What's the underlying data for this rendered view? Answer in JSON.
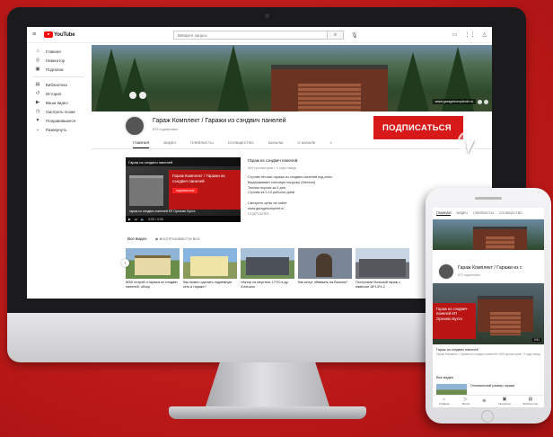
{
  "topbar": {
    "logo_text": "YouTube",
    "search_placeholder": "Введите запрос"
  },
  "sidebar": {
    "items": [
      {
        "icon": "home-icon",
        "glyph": "⌂",
        "label": "Главная"
      },
      {
        "icon": "compass-icon",
        "glyph": "◎",
        "label": "Навигатор"
      },
      {
        "icon": "subscriptions-icon",
        "glyph": "▣",
        "label": "Подписки"
      },
      {
        "icon": "library-icon",
        "glyph": "▤",
        "label": "Библиотека"
      },
      {
        "icon": "history-icon",
        "glyph": "↺",
        "label": "История"
      },
      {
        "icon": "my-videos-icon",
        "glyph": "▶",
        "label": "Ваши видео"
      },
      {
        "icon": "watch-later-icon",
        "glyph": "◷",
        "label": "Смотреть позже"
      },
      {
        "icon": "liked-icon",
        "glyph": "♥",
        "label": "Понравившиеся"
      },
      {
        "icon": "expand-icon",
        "glyph": "⌄",
        "label": "Развернуть"
      }
    ]
  },
  "banner": {
    "link_text": "www.garagekompleckt.ru"
  },
  "channel": {
    "title": "Гараж Комплект / Гаражи из сэндвич панелей",
    "subscribers": "672 подписчика",
    "subscribe_label": "ПОДПИСАТЬСЯ",
    "tabs": [
      "ГЛАВНАЯ",
      "ВИДЕО",
      "ПЛЕЙЛИСТЫ",
      "СООБЩЕСТВО",
      "КАНАЛЫ",
      "О КАНАЛЕ"
    ]
  },
  "featured": {
    "thumb_title": "Гараж из сэндвич панелей",
    "thumb_red_text": "Гараж Комплект / Гаражи из сэндвич панелей",
    "thumb_red_btn": "подписаться",
    "thumb_brand": "гараж из сэндвич-панелей КП Орехово Бухта",
    "thumb_time": "0:00 / 0:00",
    "title": "Гараж из сэндвич панелей",
    "meta": "849 просмотров • 3 года назад",
    "lines": [
      "Строим тёплые гаражи из сэндвич-панелей под ключ.",
      "Выдерживают снеговую нагрузку (Металл)",
      "Теплые ворота за 5 дня",
      "Строим за 5-10 рабочих дней",
      "",
      "Смотрите цены на сайте",
      "www.garagekomplekt.ru"
    ],
    "more": "ПОДРОБНЕЕ"
  },
  "shelf": {
    "title": "Все видео",
    "play_all": "ВОСПРОИЗВЕСТИ ВСЕ",
    "cards": [
      {
        "caption": "ЖБК потрей и гаражи из сэндвич панелей, обзор"
      },
      {
        "caption": "Как можно сделать подземную гать и гараже?"
      },
      {
        "caption": "«Актор из мертных 17*20 в ду. Хочешно"
      },
      {
        "caption": "Как могут обвивать на Визона?"
      },
      {
        "caption": "Построили большой гараж с навесом 18*13*4,2"
      }
    ]
  },
  "phone": {
    "tabs": [
      "ГЛАВНАЯ",
      "ВИДЕО",
      "ПЛЕЙЛИСТЫ",
      "СООБЩЕСТВО"
    ],
    "title": "Гараж Комплект / Гаражи из с",
    "subscribers": "672 подписчика",
    "video_red_text": "Гараж из сэндвич-панелей КП Орехово Бухта",
    "video_time": "0:51",
    "video_title": "Гараж из сэндвич панелей",
    "video_meta": "Гараж Комплект / Гаражи из сэндвич панелей • 849 просмотров • 3 года назад",
    "section": "Все видео",
    "row_text": "Оптимальный размер гаража",
    "nav": [
      "Главная",
      "Shorts",
      "",
      "Подписки",
      "Библиотека"
    ]
  },
  "colors": {
    "background": "#c81e1e",
    "accent": "#d71919"
  }
}
